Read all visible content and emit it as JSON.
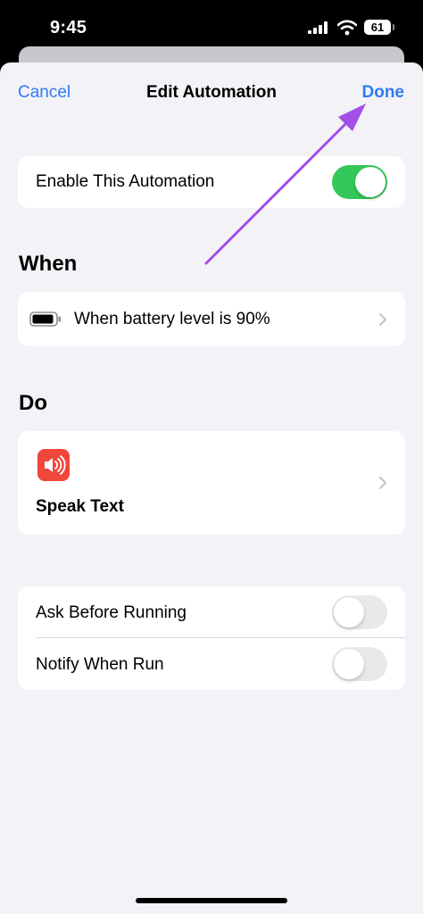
{
  "status_bar": {
    "time": "9:45",
    "battery_level": "61",
    "icons": [
      "cellular-signal-icon",
      "wifi-icon",
      "battery-icon"
    ]
  },
  "nav": {
    "cancel_label": "Cancel",
    "title": "Edit Automation",
    "done_label": "Done"
  },
  "enable_row": {
    "label": "Enable This Automation",
    "enabled": true
  },
  "when_section": {
    "header": "When",
    "trigger_label": "When battery level is 90%",
    "icon": "battery-level-icon"
  },
  "do_section": {
    "header": "Do",
    "action_label": "Speak Text",
    "icon": "speaker-icon",
    "icon_color": "#f0473b"
  },
  "options": {
    "ask_before_running": {
      "label": "Ask Before Running",
      "enabled": false
    },
    "notify_when_run": {
      "label": "Notify When Run",
      "enabled": false
    }
  },
  "colors": {
    "accent": "#2f7bf5",
    "toggle_on": "#34c759",
    "annotation_arrow": "#a44ee8",
    "background": "#f2f2f7"
  }
}
